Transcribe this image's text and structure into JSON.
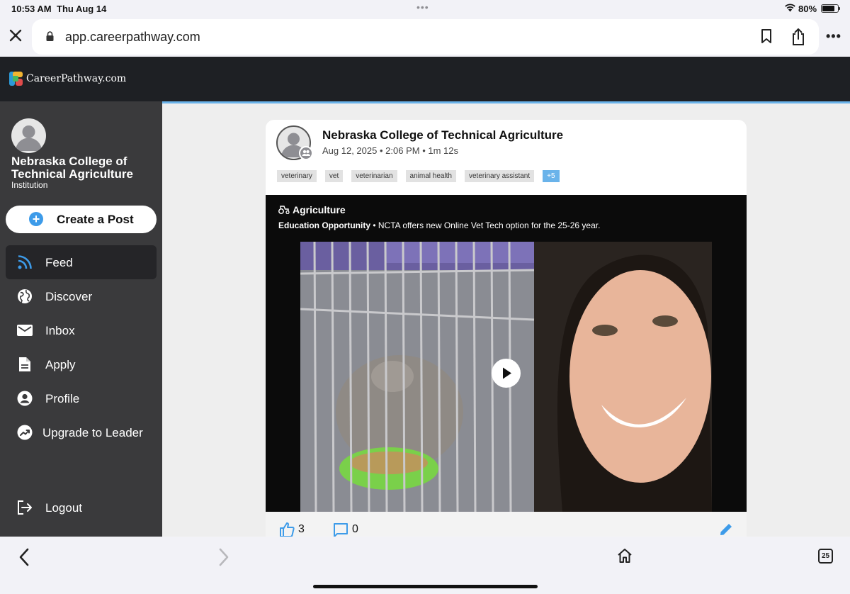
{
  "status_bar": {
    "time": "10:53 AM",
    "date": "Thu Aug 14",
    "battery_percent": "80%",
    "battery_level": 0.8
  },
  "browser": {
    "url": "app.careerpathway.com",
    "tab_count": "25"
  },
  "app": {
    "brand": "CareerPathway.com",
    "colors": {
      "header_bg": "#1e2024",
      "sidebar_bg": "#3a3a3c",
      "accent": "#3d9be9"
    }
  },
  "sidebar": {
    "org_name": "Nebraska College of Technical Agriculture",
    "org_type": "Institution",
    "create_post_label": "Create a Post",
    "nav": [
      {
        "label": "Feed",
        "icon": "rss-icon",
        "active": true
      },
      {
        "label": "Discover",
        "icon": "globe-icon",
        "active": false
      },
      {
        "label": "Inbox",
        "icon": "mail-icon",
        "active": false
      },
      {
        "label": "Apply",
        "icon": "document-icon",
        "active": false
      },
      {
        "label": "Profile",
        "icon": "account-icon",
        "active": false
      },
      {
        "label": "Upgrade to Leader",
        "icon": "trending-up-icon",
        "active": false
      }
    ],
    "logout_label": "Logout"
  },
  "post": {
    "author": "Nebraska College of Technical Agriculture",
    "date": "Aug 12, 2025",
    "time": "2:06 PM",
    "duration": "1m 12s",
    "tags": [
      "veterinary",
      "vet",
      "veterinarian",
      "animal health",
      "veterinary assistant"
    ],
    "more_tags": "+5",
    "category": "Agriculture",
    "category_icon": "tractor-icon",
    "opportunity_label": "Education Opportunity",
    "opportunity_text": "NCTA offers new Online Vet Tech option for the 25-26 year.",
    "likes": "3",
    "comments": "0"
  }
}
